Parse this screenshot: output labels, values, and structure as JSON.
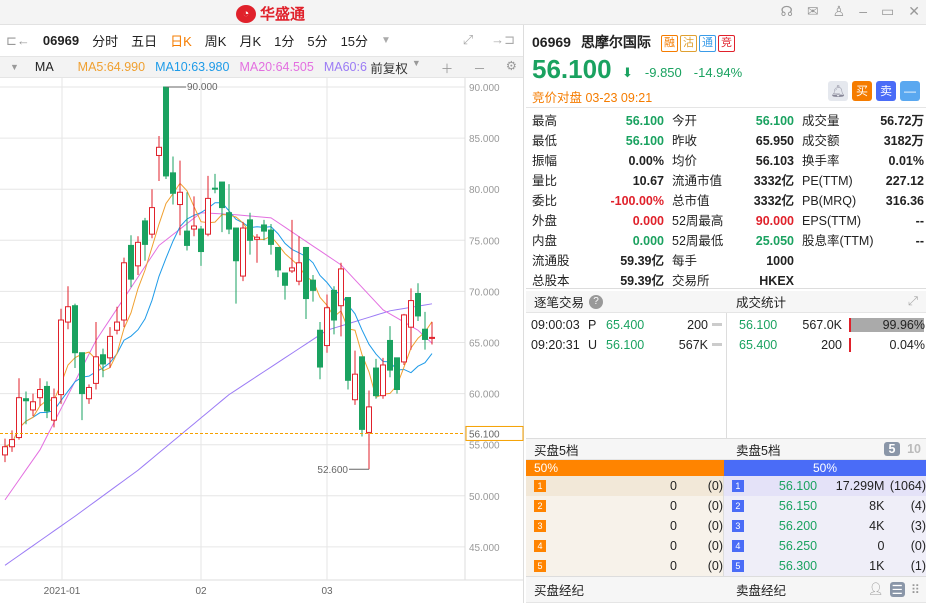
{
  "app": {
    "logo": "华盛通",
    "icons": [
      "headset-icon",
      "mail-icon",
      "shirt-icon",
      "minimize-icon",
      "maximize-icon",
      "close-icon"
    ]
  },
  "toolbar": {
    "code": "06969",
    "periods": [
      "分时",
      "五日",
      "日K",
      "周K",
      "月K",
      "1分",
      "5分",
      "15分"
    ],
    "active": "日K"
  },
  "ma": {
    "label": "MA",
    "ma5": "MA5:64.990",
    "ma10": "MA10:63.980",
    "ma20": "MA20:64.505",
    "ma60": "MA60:6",
    "adjust": "前复权",
    "colors": {
      "ma5": "#f0a030",
      "ma10": "#1e9be8",
      "ma20": "#e36fe0",
      "ma60": "#9b7bf5"
    }
  },
  "chart_data": {
    "type": "candlestick",
    "yticks": [
      "90.000",
      "85.000",
      "80.000",
      "75.000",
      "70.000",
      "65.000",
      "60.000",
      "55.000",
      "50.000",
      "45.000"
    ],
    "ylim": [
      43,
      90.6
    ],
    "xlabels": [
      {
        "label": "2021-01",
        "index": 8
      },
      {
        "label": "02",
        "index": 28
      },
      {
        "label": "03",
        "index": 46
      }
    ],
    "high_label": "90.000",
    "low_label": "52.600",
    "last_label": "56.100",
    "last": 56.1,
    "ohlc": [
      [
        54,
        54.8,
        55.6,
        53.3
      ],
      [
        54.8,
        55.5,
        56.4,
        54.3
      ],
      [
        55.7,
        59.6,
        61.5,
        55.5
      ],
      [
        59.5,
        59.3,
        60.2,
        57
      ],
      [
        58.4,
        59.2,
        60,
        57.8
      ],
      [
        59.6,
        60.4,
        61.5,
        58.8
      ],
      [
        60.7,
        58.3,
        61.2,
        57.6
      ],
      [
        57.4,
        59.6,
        60.5,
        56.7
      ],
      [
        59.9,
        67.2,
        68.3,
        59
      ],
      [
        67,
        68.5,
        70.5,
        66.3
      ],
      [
        68.6,
        64,
        68.8,
        62.5
      ],
      [
        64,
        60,
        64,
        57.4
      ],
      [
        59.5,
        60.6,
        60.9,
        59
      ],
      [
        61,
        63.6,
        67,
        60.4
      ],
      [
        63.8,
        62.9,
        64.4,
        61.6
      ],
      [
        63.5,
        65.6,
        66.5,
        62.5
      ],
      [
        66.2,
        67,
        68.5,
        65.8
      ],
      [
        67.2,
        72.8,
        73.3,
        66.5
      ],
      [
        74.5,
        71.2,
        75.5,
        70.4
      ],
      [
        72.5,
        74.8,
        75.4,
        71.6
      ],
      [
        76.9,
        74.6,
        77.2,
        73
      ],
      [
        75.6,
        78.2,
        80,
        75.2
      ],
      [
        83.3,
        84.1,
        85.2,
        80.8
      ],
      [
        90,
        81.3,
        90,
        81
      ],
      [
        81.6,
        79.6,
        83.2,
        78.5
      ],
      [
        78.5,
        79.7,
        82.8,
        75.5
      ],
      [
        75.9,
        74.5,
        79.7,
        74
      ],
      [
        76.1,
        76.4,
        79.3,
        75.4
      ],
      [
        76.1,
        73.9,
        76.4,
        72.5
      ],
      [
        75.6,
        79.1,
        81.3,
        75.4
      ],
      [
        80.1,
        80,
        81.5,
        79.6
      ],
      [
        80.7,
        78.2,
        80.7,
        75.8
      ],
      [
        77.7,
        76.1,
        80.5,
        75.6
      ],
      [
        76.2,
        73,
        76.2,
        68.8
      ],
      [
        71.5,
        76.2,
        76.8,
        71
      ],
      [
        77,
        75,
        77.7,
        73.6
      ],
      [
        75.1,
        75.3,
        75.6,
        72.8
      ],
      [
        76.5,
        75.9,
        77,
        75
      ],
      [
        76,
        74.6,
        76.6,
        73.6
      ],
      [
        74.3,
        72.1,
        74.3,
        71.4
      ],
      [
        71.8,
        70.6,
        71.8,
        69.2
      ],
      [
        72,
        72.3,
        77,
        71.8
      ],
      [
        71,
        72.8,
        75.4,
        70.6
      ],
      [
        74.3,
        69.3,
        74.3,
        67.3
      ],
      [
        71.1,
        70.1,
        71.6,
        69
      ],
      [
        66.2,
        62.6,
        67,
        61.4
      ],
      [
        64.7,
        68.4,
        69.7,
        64
      ],
      [
        70.1,
        67.2,
        70.5,
        65.8
      ],
      [
        68.6,
        72.2,
        72.8,
        65.6
      ],
      [
        69.4,
        61.3,
        69.4,
        60.4
      ],
      [
        59.4,
        61.9,
        64.2,
        58.9
      ],
      [
        63.6,
        56.5,
        63.6,
        55.8
      ],
      [
        56.2,
        58.7,
        60.3,
        52.6
      ],
      [
        62.5,
        59.8,
        63.4,
        59.5
      ],
      [
        59.8,
        62.8,
        63.5,
        59.5
      ],
      [
        65.2,
        62.3,
        66.6,
        61.6
      ],
      [
        63.5,
        60.4,
        63.5,
        60
      ],
      [
        63.1,
        67.7,
        67.8,
        62.8
      ],
      [
        66.5,
        69.1,
        70.3,
        64.3
      ],
      [
        69.8,
        67.6,
        70.8,
        67.1
      ],
      [
        66.3,
        65.3,
        68,
        64.3
      ],
      [
        65.4,
        65.5,
        67,
        64.8
      ]
    ],
    "ma20": [
      [
        0,
        49.6
      ],
      [
        5,
        54.5
      ],
      [
        13,
        65.2
      ],
      [
        22,
        74.5
      ],
      [
        28,
        77.7
      ],
      [
        33,
        77.5
      ],
      [
        38,
        77.2
      ],
      [
        48,
        72.6
      ],
      [
        54,
        68.2
      ],
      [
        59,
        66.2
      ],
      [
        62,
        64.3
      ]
    ],
    "ma60": [
      [
        0,
        43.2
      ],
      [
        10,
        48
      ],
      [
        19,
        52.5
      ],
      [
        32,
        59.9
      ],
      [
        46,
        66.2
      ],
      [
        55,
        68.1
      ],
      [
        62,
        68.9
      ]
    ]
  },
  "quote": {
    "code": "06969",
    "name": "思摩尔国际",
    "tags": [
      "融",
      "沽",
      "通",
      "竞"
    ],
    "price": "56.100",
    "change": "-9.850",
    "pct": "-14.94%",
    "auction": "竞价对盘 03-23 09:21",
    "buy": "买",
    "sell": "卖"
  },
  "stats": [
    [
      {
        "l": "最高",
        "v": "56.100",
        "c": "g"
      },
      {
        "l": "今开",
        "v": "56.100",
        "c": "g"
      },
      {
        "l": "成交量",
        "v": "56.72万",
        "c": ""
      }
    ],
    [
      {
        "l": "最低",
        "v": "56.100",
        "c": "g"
      },
      {
        "l": "昨收",
        "v": "65.950",
        "c": ""
      },
      {
        "l": "成交额",
        "v": "3182万",
        "c": ""
      }
    ],
    [
      {
        "l": "振幅",
        "v": "0.00%",
        "c": ""
      },
      {
        "l": "均价",
        "v": "56.103",
        "c": ""
      },
      {
        "l": "换手率",
        "v": "0.01%",
        "c": ""
      }
    ],
    [
      {
        "l": "量比",
        "v": "10.67",
        "c": ""
      },
      {
        "l": "流通市值",
        "v": "3332亿",
        "c": ""
      },
      {
        "l": "PE(TTM)",
        "v": "227.12",
        "c": ""
      }
    ],
    [
      {
        "l": "委比",
        "v": "-100.00%",
        "c": "rd"
      },
      {
        "l": "总市值",
        "v": "3332亿",
        "c": ""
      },
      {
        "l": "PB(MRQ)",
        "v": "316.36",
        "c": ""
      }
    ],
    [
      {
        "l": "外盘",
        "v": "0.000",
        "c": "rd"
      },
      {
        "l": "52周最高",
        "v": "90.000",
        "c": "rd"
      },
      {
        "l": "EPS(TTM)",
        "v": "--",
        "c": ""
      }
    ],
    [
      {
        "l": "内盘",
        "v": "0.000",
        "c": "g"
      },
      {
        "l": "52周最低",
        "v": "25.050",
        "c": "g"
      },
      {
        "l": "股息率(TTM)",
        "v": "--",
        "c": ""
      }
    ],
    [
      {
        "l": "流通股",
        "v": "59.39亿",
        "c": ""
      },
      {
        "l": "每手",
        "v": "1000",
        "c": ""
      },
      {
        "l": "",
        "v": "",
        "c": ""
      }
    ],
    [
      {
        "l": "总股本",
        "v": "59.39亿",
        "c": ""
      },
      {
        "l": "交易所",
        "v": "HKEX",
        "c": ""
      },
      {
        "l": "",
        "v": "",
        "c": ""
      }
    ]
  ],
  "trades": {
    "title": "逐笔交易",
    "stats_title": "成交统计",
    "rows": [
      {
        "time": "09:00:03",
        "type": "P",
        "price": "65.400",
        "vol": "200"
      },
      {
        "time": "09:20:31",
        "type": "U",
        "price": "56.100",
        "vol": "567K"
      }
    ],
    "stat_rows": [
      {
        "price": "56.100",
        "vol": "567.0K",
        "pct": "99.96%",
        "frac": 0.9996
      },
      {
        "price": "65.400",
        "vol": "200",
        "pct": "0.04%",
        "frac": 0.0004
      }
    ]
  },
  "orderbook": {
    "bid_title": "买盘5档",
    "ask_title": "卖盘5档",
    "depth5": "5",
    "depth10": "10",
    "bid_pct": "50%",
    "ask_pct": "50%",
    "bids": [
      {
        "n": "1",
        "vol": "0",
        "cnt": "(0)"
      },
      {
        "n": "2",
        "vol": "0",
        "cnt": "(0)"
      },
      {
        "n": "3",
        "vol": "0",
        "cnt": "(0)"
      },
      {
        "n": "4",
        "vol": "0",
        "cnt": "(0)"
      },
      {
        "n": "5",
        "vol": "0",
        "cnt": "(0)"
      }
    ],
    "asks": [
      {
        "n": "1",
        "price": "56.100",
        "vol": "17.299M",
        "cnt": "(1064)"
      },
      {
        "n": "2",
        "price": "56.150",
        "vol": "8K",
        "cnt": "(4)"
      },
      {
        "n": "3",
        "price": "56.200",
        "vol": "4K",
        "cnt": "(3)"
      },
      {
        "n": "4",
        "price": "56.250",
        "vol": "0",
        "cnt": "(0)"
      },
      {
        "n": "5",
        "price": "56.300",
        "vol": "1K",
        "cnt": "(1)"
      }
    ],
    "bid_broker": "买盘经纪",
    "ask_broker": "卖盘经纪"
  }
}
